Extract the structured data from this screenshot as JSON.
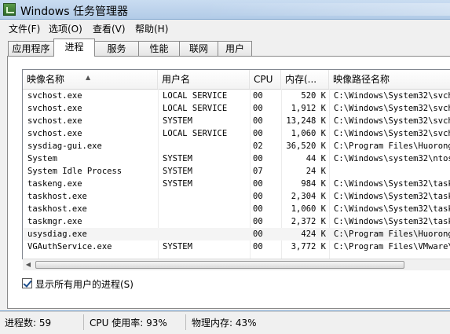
{
  "window": {
    "title": "Windows 任务管理器"
  },
  "menu": [
    "文件(F)",
    "选项(O)",
    "查看(V)",
    "帮助(H)"
  ],
  "tabs": [
    {
      "label": "应用程序",
      "active": false
    },
    {
      "label": "进程",
      "active": true
    },
    {
      "label": "服务",
      "active": false
    },
    {
      "label": "性能",
      "active": false
    },
    {
      "label": "联网",
      "active": false
    },
    {
      "label": "用户",
      "active": false
    }
  ],
  "columns": [
    "映像名称",
    "用户名",
    "CPU",
    "内存(...",
    "映像路径名称"
  ],
  "rows": [
    {
      "name": "svchost.exe",
      "user": "LOCAL SERVICE",
      "cpu": "00",
      "mem": "520 K",
      "path": "C:\\Windows\\System32\\svcho"
    },
    {
      "name": "svchost.exe",
      "user": "LOCAL SERVICE",
      "cpu": "00",
      "mem": "1,912 K",
      "path": "C:\\Windows\\System32\\svcho"
    },
    {
      "name": "svchost.exe",
      "user": "SYSTEM",
      "cpu": "00",
      "mem": "13,248 K",
      "path": "C:\\Windows\\System32\\svcho"
    },
    {
      "name": "svchost.exe",
      "user": "LOCAL SERVICE",
      "cpu": "00",
      "mem": "1,060 K",
      "path": "C:\\Windows\\System32\\svcho"
    },
    {
      "name": "sysdiag-gui.exe",
      "user": "",
      "cpu": "02",
      "mem": "36,520 K",
      "path": "C:\\Program Files\\Huorong\\"
    },
    {
      "name": "System",
      "user": "SYSTEM",
      "cpu": "00",
      "mem": "44 K",
      "path": "C:\\Windows\\system32\\ntosk"
    },
    {
      "name": "System Idle Process",
      "user": "SYSTEM",
      "cpu": "07",
      "mem": "24 K",
      "path": ""
    },
    {
      "name": "taskeng.exe",
      "user": "SYSTEM",
      "cpu": "00",
      "mem": "984 K",
      "path": "C:\\Windows\\System32\\taske"
    },
    {
      "name": "taskhost.exe",
      "user": "",
      "cpu": "00",
      "mem": "2,304 K",
      "path": "C:\\Windows\\System32\\taskh"
    },
    {
      "name": "taskhost.exe",
      "user": "",
      "cpu": "00",
      "mem": "1,060 K",
      "path": "C:\\Windows\\System32\\taskh"
    },
    {
      "name": "taskmgr.exe",
      "user": "",
      "cpu": "00",
      "mem": "2,372 K",
      "path": "C:\\Windows\\System32\\taskm"
    },
    {
      "name": "usysdiag.exe",
      "user": "",
      "cpu": "00",
      "mem": "424 K",
      "path": "C:\\Program Files\\Huorong\\"
    },
    {
      "name": "VGAuthService.exe",
      "user": "SYSTEM",
      "cpu": "00",
      "mem": "3,772 K",
      "path": "C:\\Program Files\\VMware\\V"
    }
  ],
  "show_all_users": {
    "label": "显示所有用户的进程(S)",
    "checked": true
  },
  "status": {
    "processes": "进程数: 59",
    "cpu": "CPU 使用率: 93%",
    "memory": "物理内存: 43%"
  }
}
